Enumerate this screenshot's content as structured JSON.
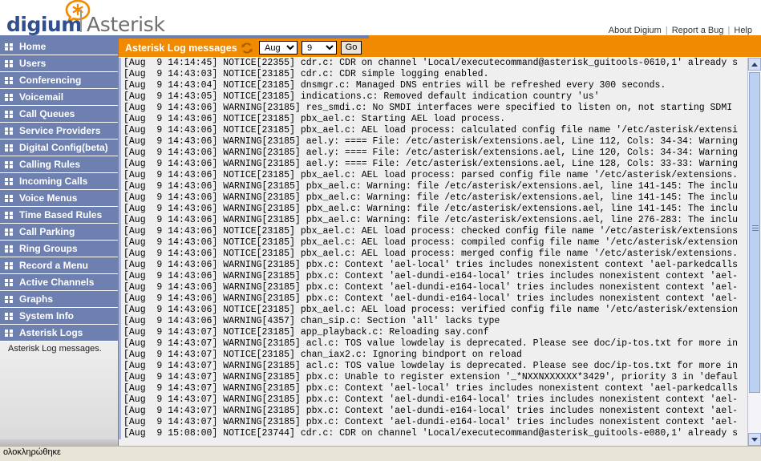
{
  "brand": {
    "digium": "digium",
    "asterisk": "Asterisk",
    "star_icon": "asterisk-star-icon",
    "accent_orange": "#f08a00",
    "accent_blue": "#6b7fb5"
  },
  "topnav": {
    "links": [
      {
        "label": "About Digium"
      },
      {
        "label": "Report a Bug"
      },
      {
        "label": "Help"
      }
    ],
    "separator": "|"
  },
  "sidebar": {
    "items": [
      {
        "label": "Home",
        "icon": "grid-icon"
      },
      {
        "label": "Users",
        "icon": "grid-icon"
      },
      {
        "label": "Conferencing",
        "icon": "grid-icon"
      },
      {
        "label": "Voicemail",
        "icon": "grid-icon"
      },
      {
        "label": "Call Queues",
        "icon": "grid-icon"
      },
      {
        "label": "Service Providers",
        "icon": "grid-icon"
      },
      {
        "label": "Digital Config(beta)",
        "icon": "grid-icon"
      },
      {
        "label": "Calling Rules",
        "icon": "grid-icon"
      },
      {
        "label": "Incoming Calls",
        "icon": "grid-icon"
      },
      {
        "label": "Voice Menus",
        "icon": "grid-icon"
      },
      {
        "label": "Time Based Rules",
        "icon": "grid-icon"
      },
      {
        "label": "Call Parking",
        "icon": "grid-icon"
      },
      {
        "label": "Ring Groups",
        "icon": "grid-icon"
      },
      {
        "label": "Record a Menu",
        "icon": "grid-icon"
      },
      {
        "label": "Active Channels",
        "icon": "grid-icon"
      },
      {
        "label": "Graphs",
        "icon": "grid-icon"
      },
      {
        "label": "System Info",
        "icon": "grid-icon"
      },
      {
        "label": "Asterisk Logs",
        "icon": "grid-icon"
      }
    ],
    "description": "Asterisk Log messages."
  },
  "panel": {
    "title": "Asterisk Log messages",
    "refresh_icon": "refresh-icon",
    "month_value": "Aug",
    "day_value": "9",
    "go_label": "Go"
  },
  "statusbar": {
    "text": "ολοκληρώθηκε"
  },
  "log": {
    "lines": [
      "[Aug  9 14:14:45] NOTICE[22355] cdr.c: CDR on channel 'Local/executecommand@asterisk_guitools-0610,1' already s",
      "[Aug  9 14:43:03] NOTICE[23185] cdr.c: CDR simple logging enabled.",
      "[Aug  9 14:43:04] NOTICE[23185] dnsmgr.c: Managed DNS entries will be refreshed every 300 seconds.",
      "[Aug  9 14:43:05] NOTICE[23185] indications.c: Removed default indication country 'us'",
      "[Aug  9 14:43:06] WARNING[23185] res_smdi.c: No SMDI interfaces were specified to listen on, not starting SDMI",
      "[Aug  9 14:43:06] NOTICE[23185] pbx_ael.c: Starting AEL load process.",
      "[Aug  9 14:43:06] NOTICE[23185] pbx_ael.c: AEL load process: calculated config file name '/etc/asterisk/extensi",
      "[Aug  9 14:43:06] WARNING[23185] ael.y: ==== File: /etc/asterisk/extensions.ael, Line 112, Cols: 34-34: Warning",
      "[Aug  9 14:43:06] WARNING[23185] ael.y: ==== File: /etc/asterisk/extensions.ael, Line 120, Cols: 34-34: Warning",
      "[Aug  9 14:43:06] WARNING[23185] ael.y: ==== File: /etc/asterisk/extensions.ael, Line 128, Cols: 33-33: Warning",
      "[Aug  9 14:43:06] NOTICE[23185] pbx_ael.c: AEL load process: parsed config file name '/etc/asterisk/extensions.",
      "[Aug  9 14:43:06] WARNING[23185] pbx_ael.c: Warning: file /etc/asterisk/extensions.ael, line 141-145: The inclu",
      "[Aug  9 14:43:06] WARNING[23185] pbx_ael.c: Warning: file /etc/asterisk/extensions.ael, line 141-145: The inclu",
      "[Aug  9 14:43:06] WARNING[23185] pbx_ael.c: Warning: file /etc/asterisk/extensions.ael, line 141-145: The inclu",
      "[Aug  9 14:43:06] WARNING[23185] pbx_ael.c: Warning: file /etc/asterisk/extensions.ael, line 276-283: The inclu",
      "[Aug  9 14:43:06] NOTICE[23185] pbx_ael.c: AEL load process: checked config file name '/etc/asterisk/extensions",
      "[Aug  9 14:43:06] NOTICE[23185] pbx_ael.c: AEL load process: compiled config file name '/etc/asterisk/extension",
      "[Aug  9 14:43:06] NOTICE[23185] pbx_ael.c: AEL load process: merged config file name '/etc/asterisk/extensions.",
      "[Aug  9 14:43:06] WARNING[23185] pbx.c: Context 'ael-local' tries includes nonexistent context 'ael-parkedcalls",
      "[Aug  9 14:43:06] WARNING[23185] pbx.c: Context 'ael-dundi-e164-local' tries includes nonexistent context 'ael-",
      "[Aug  9 14:43:06] WARNING[23185] pbx.c: Context 'ael-dundi-e164-local' tries includes nonexistent context 'ael-",
      "[Aug  9 14:43:06] WARNING[23185] pbx.c: Context 'ael-dundi-e164-local' tries includes nonexistent context 'ael-",
      "[Aug  9 14:43:06] NOTICE[23185] pbx_ael.c: AEL load process: verified config file name '/etc/asterisk/extension",
      "[Aug  9 14:43:06] WARNING[4357] chan_sip.c: Section 'all' lacks type",
      "[Aug  9 14:43:07] NOTICE[23185] app_playback.c: Reloading say.conf",
      "[Aug  9 14:43:07] WARNING[23185] acl.c: TOS value lowdelay is deprecated. Please see doc/ip-tos.txt for more in",
      "[Aug  9 14:43:07] NOTICE[23185] chan_iax2.c: Ignoring bindport on reload",
      "[Aug  9 14:43:07] WARNING[23185] acl.c: TOS value lowdelay is deprecated. Please see doc/ip-tos.txt for more in",
      "[Aug  9 14:43:07] WARNING[23185] pbx.c: Unable to register extension '_*NXXNXXXXXX*3429', priority 3 in 'defaul",
      "[Aug  9 14:43:07] WARNING[23185] pbx.c: Context 'ael-local' tries includes nonexistent context 'ael-parkedcalls",
      "[Aug  9 14:43:07] WARNING[23185] pbx.c: Context 'ael-dundi-e164-local' tries includes nonexistent context 'ael-",
      "[Aug  9 14:43:07] WARNING[23185] pbx.c: Context 'ael-dundi-e164-local' tries includes nonexistent context 'ael-",
      "[Aug  9 14:43:07] WARNING[23185] pbx.c: Context 'ael-dundi-e164-local' tries includes nonexistent context 'ael-",
      "[Aug  9 15:08:00] NOTICE[23744] cdr.c: CDR on channel 'Local/executecommand@asterisk_guitools-e080,1' already s"
    ]
  }
}
